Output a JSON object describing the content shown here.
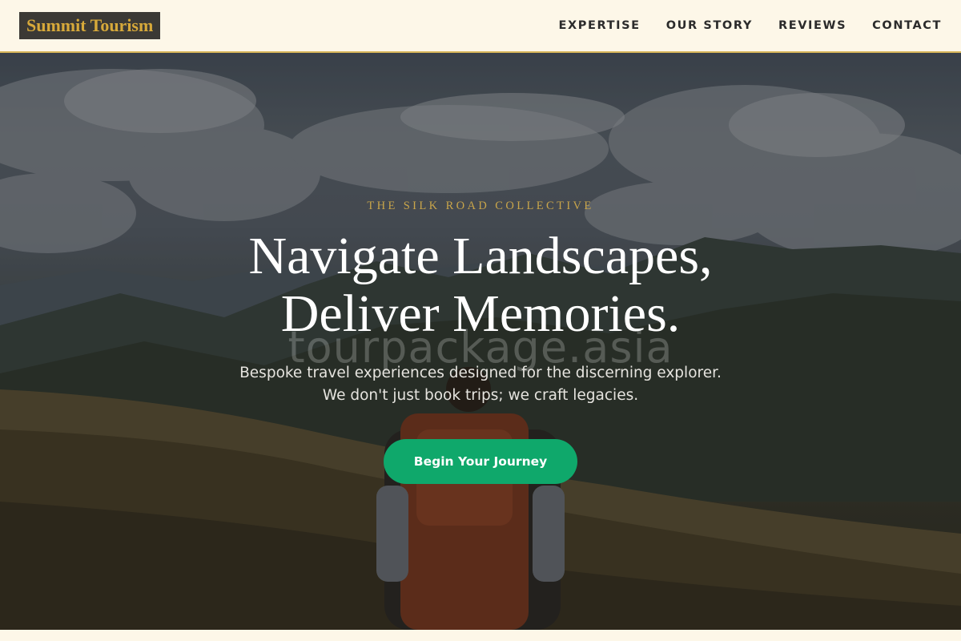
{
  "header": {
    "logo": "Summit Tourism",
    "nav": [
      {
        "label": "EXPERTISE"
      },
      {
        "label": "OUR STORY"
      },
      {
        "label": "REVIEWS"
      },
      {
        "label": "CONTACT"
      }
    ]
  },
  "hero": {
    "eyebrow": "THE SILK ROAD COLLECTIVE",
    "title_line1": "Navigate Landscapes,",
    "title_line2": "Deliver Memories.",
    "watermark": "tourpackage.asia",
    "subtitle_line1": "Bespoke travel experiences designed for the discerning explorer.",
    "subtitle_line2": "We don't just book trips; we craft legacies.",
    "cta_label": "Begin Your Journey"
  },
  "colors": {
    "accent_gold": "#d7a93a",
    "cta_green": "#0fa86b",
    "header_bg": "#fdf7e8",
    "logo_bg": "#3b3935"
  }
}
